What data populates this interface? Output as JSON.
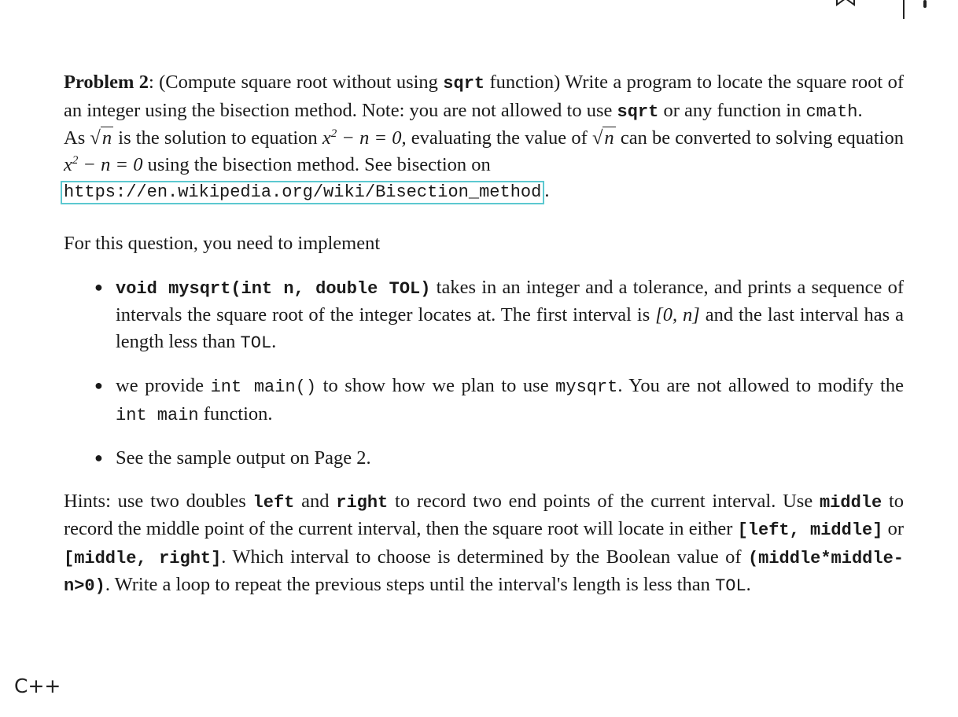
{
  "toolbar": {
    "icons": [
      "bookmark-icon",
      "more-icon"
    ]
  },
  "problem": {
    "title": "Problem 2",
    "title_colon": ":",
    "intro_1": " (Compute square root without using ",
    "code_sqrt": "sqrt",
    "intro_2": " function) Write a program to locate the square root of an integer using the bisection method. Note: you are not allowed to use ",
    "code_sqrt_2": "sqrt",
    "intro_3": " or any function in ",
    "code_cmath": "cmath",
    "intro_4": ".",
    "para2_a": "As ",
    "sqrt_n": "n",
    "para2_b": " is the solution to equation ",
    "eq_x": "x",
    "eq_exp": "2",
    "eq_rest": " − n = 0",
    "para2_c": ", evaluating the value of ",
    "para2_d": " can be converted to solving equation ",
    "para2_e": " using the bisection method. See bisection on ",
    "link": "https://en.wikipedia.org/wiki/Bisection_method",
    "link_end": "."
  },
  "implement_intro": "For this question, you need to implement",
  "bullets": [
    {
      "code": "void mysqrt(int n, double TOL)",
      "text_a": " takes in an integer and a tolerance, and prints a sequence of intervals the square root of the integer locates at. The first interval is ",
      "interval": "[0, n]",
      "text_b": " and the last interval has a length less than ",
      "code_tol": "TOL",
      "text_c": "."
    },
    {
      "text_a": "we provide ",
      "code_main": "int main()",
      "text_b": " to show how we plan to use ",
      "code_mysqrt": "mysqrt",
      "text_c": ". You are not allowed to modify the ",
      "code_main2": "int main",
      "text_d": " function."
    },
    {
      "text": "See the sample output on Page 2."
    }
  ],
  "hints": {
    "a": "Hints: use two doubles ",
    "left": "left",
    "b": " and ",
    "right": "right",
    "c": " to record two end points of the current interval. Use ",
    "middle": "middle",
    "d": " to record the middle point of the current interval, then the square root will locate in either ",
    "int1": "[left, middle]",
    "e": " or ",
    "int2": "[middle, right]",
    "f": ". Which interval to choose is determined by the Boolean value of ",
    "cond": "(middle*middle-n>0)",
    "g": ". Write a loop to repeat the previous steps until the interval's length is less than ",
    "tol": "TOL",
    "h": "."
  },
  "language_label": "C++"
}
